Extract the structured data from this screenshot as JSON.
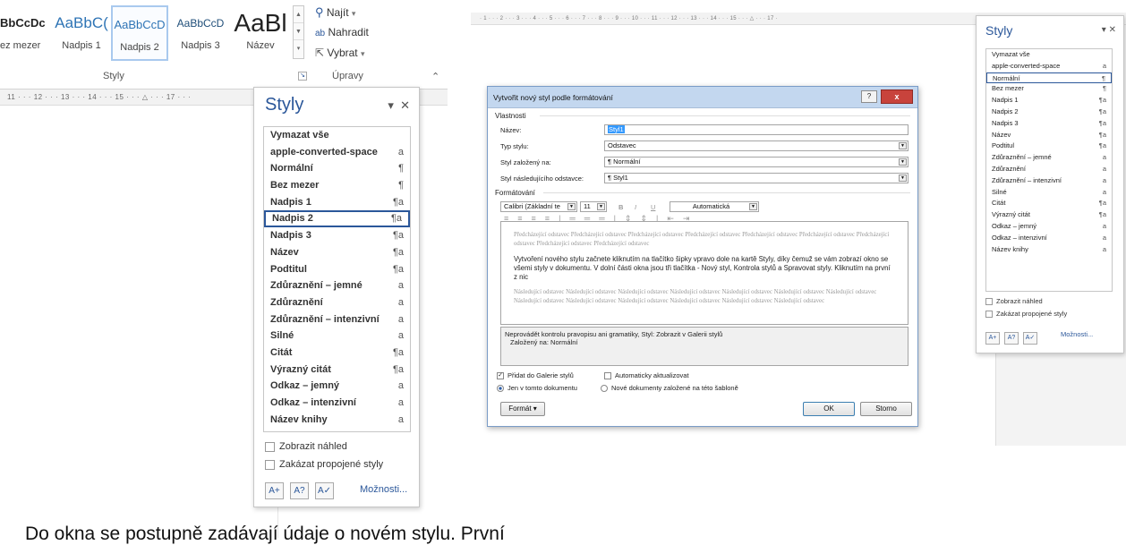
{
  "ribbon": {
    "gallery": [
      {
        "preview": "BbCcDc",
        "label": "ez mezer"
      },
      {
        "preview": "AaBbC(",
        "label": "Nadpis 1"
      },
      {
        "preview": "AaBbCcD",
        "label": "Nadpis 2"
      },
      {
        "preview": "AaBbCcD",
        "label": "Nadpis 3"
      },
      {
        "preview": "AaBl",
        "label": "Název"
      }
    ],
    "group_styles": "Styly",
    "group_edit": "Úpravy",
    "find": "Najít",
    "replace": "Nahradit",
    "select": "Vybrat",
    "ruler": "11 · · · 12 · · · 13 · · · 14 · · · 15 · · · △ · · · 17 · · ·"
  },
  "pane_left": {
    "title": "Styly",
    "items": [
      {
        "label": "Vymazat vše",
        "mark": ""
      },
      {
        "label": "apple-converted-space",
        "mark": "a"
      },
      {
        "label": "Normální",
        "mark": "¶"
      },
      {
        "label": "Bez mezer",
        "mark": "¶"
      },
      {
        "label": "Nadpis 1",
        "mark": "¶a"
      },
      {
        "label": "Nadpis 2",
        "mark": "¶a"
      },
      {
        "label": "Nadpis 3",
        "mark": "¶a"
      },
      {
        "label": "Název",
        "mark": "¶a"
      },
      {
        "label": "Podtitul",
        "mark": "¶a"
      },
      {
        "label": "Zdůraznění – jemné",
        "mark": "a"
      },
      {
        "label": "Zdůraznění",
        "mark": "a"
      },
      {
        "label": "Zdůraznění – intenzivní",
        "mark": "a"
      },
      {
        "label": "Silné",
        "mark": "a"
      },
      {
        "label": "Citát",
        "mark": "¶a"
      },
      {
        "label": "Výrazný citát",
        "mark": "¶a"
      },
      {
        "label": "Odkaz – jemný",
        "mark": "a"
      },
      {
        "label": "Odkaz – intenzivní",
        "mark": "a"
      },
      {
        "label": "Název knihy",
        "mark": "a"
      }
    ],
    "selected_index": 5,
    "show_preview": "Zobrazit náhled",
    "disable_linked": "Zakázat propojené styly",
    "options": "Možnosti..."
  },
  "right_ruler": "· 1 · · · 2 · · · 3 · · · 4 · · · 5 · · · 6 · · · 7 · · · 8 · · · 9 · · · 10 · · · 11 · · · 12 · · · 13 · · · 14 · · · 15 · · · △ · · · 17 ·",
  "dialog": {
    "title": "Vytvořit nový styl podle formátování",
    "help": "?",
    "close": "x",
    "properties_legend": "Vlastnosti",
    "name_label": "Název:",
    "name_value": "Styl1",
    "type_label": "Typ stylu:",
    "type_value": "Odstavec",
    "based_label": "Styl založený na:",
    "based_value": "¶  Normální",
    "next_label": "Styl následujícího odstavce:",
    "next_value": "¶  Styl1",
    "formatting_legend": "Formátování",
    "font": "Calibri (Základní te",
    "size": "11",
    "bold": "B",
    "italic": "I",
    "underline": "U",
    "color": "Automatická",
    "preview_prev": "Předcházející odstavec Předcházející odstavec Předcházející odstavec Předcházející odstavec Předcházející odstavec Předcházející odstavec Předcházející odstavec Předcházející odstavec Předcházející odstavec",
    "preview_current": "Vytvoření nového stylu začnete kliknutím na tlačítko šipky vpravo dole na kartě Styly, díky čemuž se vám zobrazí okno se všemi styly v dokumentu. V dolní části okna jsou tři tlačítka - Nový styl, Kontrola stylů a Spravovat styly. Kliknutím na první z nic",
    "preview_next": "Následující odstavec Následující odstavec Následující odstavec Následující odstavec Následující odstavec Následující odstavec Následující odstavec Následující odstavec Následující odstavec Následující odstavec Následující odstavec Následující odstavec Následující odstavec",
    "desc_line1": "Neprovádět kontrolu pravopisu ani gramatiky, Styl: Zobrazit v Galerii stylů",
    "desc_line2": "Založený na: Normální",
    "add_gallery": "Přidat do Galerie stylů",
    "auto_update": "Automaticky aktualizovat",
    "only_doc": "Jen v tomto dokumentu",
    "new_docs": "Nové dokumenty založené na této šabloně",
    "format_btn": "Formát ▾",
    "ok": "OK",
    "cancel": "Storno"
  },
  "pane_right": {
    "title": "Styly",
    "items": [
      {
        "label": "Vymazat vše",
        "mark": ""
      },
      {
        "label": "apple-converted-space",
        "mark": "a"
      },
      {
        "label": "Normální",
        "mark": "¶"
      },
      {
        "label": "Bez mezer",
        "mark": "¶"
      },
      {
        "label": "Nadpis 1",
        "mark": "¶a"
      },
      {
        "label": "Nadpis 2",
        "mark": "¶a"
      },
      {
        "label": "Nadpis 3",
        "mark": "¶a"
      },
      {
        "label": "Název",
        "mark": "¶a"
      },
      {
        "label": "Podtitul",
        "mark": "¶a"
      },
      {
        "label": "Zdůraznění – jemné",
        "mark": "a"
      },
      {
        "label": "Zdůraznění",
        "mark": "a"
      },
      {
        "label": "Zdůraznění – intenzivní",
        "mark": "a"
      },
      {
        "label": "Silné",
        "mark": "a"
      },
      {
        "label": "Citát",
        "mark": "¶a"
      },
      {
        "label": "Výrazný citát",
        "mark": "¶a"
      },
      {
        "label": "Odkaz – jemný",
        "mark": "a"
      },
      {
        "label": "Odkaz – intenzivní",
        "mark": "a"
      },
      {
        "label": "Název knihy",
        "mark": "a"
      }
    ],
    "selected_index": 2,
    "show_preview": "Zobrazit náhled",
    "disable_linked": "Zakázat propojené styly",
    "options": "Možnosti..."
  },
  "body_text": "Do okna se postupně zadávají údaje o novém stylu. První"
}
